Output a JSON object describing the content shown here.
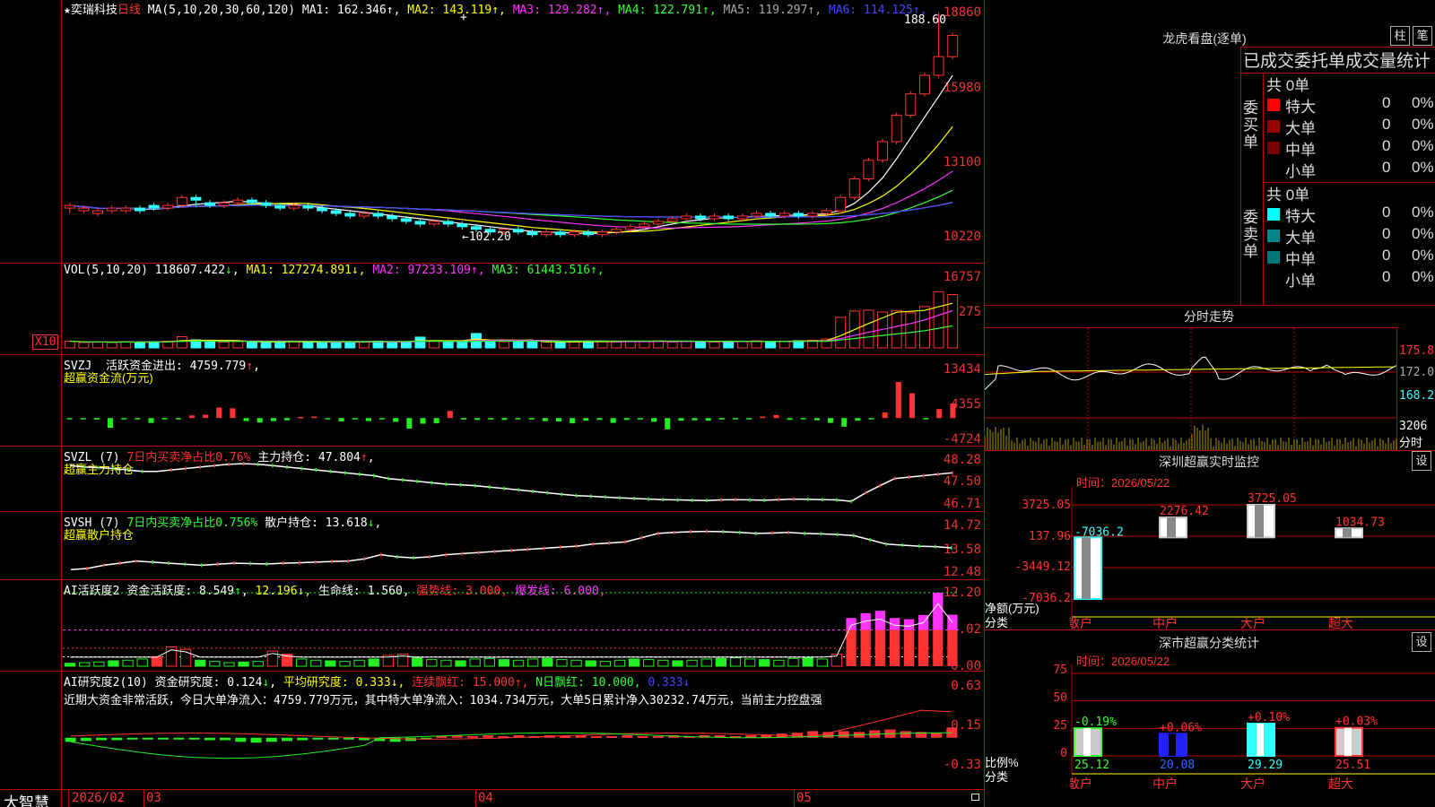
{
  "stock": {
    "name": "奕瑞科技",
    "period": "日线",
    "ma_params": "MA(5,10,20,30,60,120)",
    "ma": [
      {
        "label": "MA1:",
        "value": "162.346",
        "arrow": "↑",
        "color": "#ffffff"
      },
      {
        "label": "MA2:",
        "value": "143.119",
        "arrow": "↑",
        "color": "#ffff00"
      },
      {
        "label": "MA3:",
        "value": "129.282",
        "arrow": "↑",
        "color": "#ff33ff"
      },
      {
        "label": "MA4:",
        "value": "122.791",
        "arrow": "↑",
        "color": "#33ff33"
      },
      {
        "label": "MA5:",
        "value": "119.297",
        "arrow": "↑",
        "color": "#aaaaaa"
      },
      {
        "label": "MA6:",
        "value": "114.125",
        "arrow": "↑",
        "color": "#4444ff"
      }
    ],
    "y_labels": [
      "18860",
      "15980",
      "13100",
      "10220"
    ],
    "high_label": "188.60",
    "low_label": "102.20"
  },
  "vol": {
    "title": "VOL(5,10,20)",
    "value": "118607.422",
    "arrow": "↓",
    "ma": [
      {
        "label": "MA1:",
        "value": "127274.891",
        "arrow": "↓",
        "color": "#ffff00"
      },
      {
        "label": "MA2:",
        "value": "97233.109",
        "arrow": "↑",
        "color": "#ff33ff"
      },
      {
        "label": "MA3:",
        "value": "61443.516",
        "arrow": "↑",
        "color": "#33ff33"
      }
    ],
    "y_labels": [
      "16757",
      "8275"
    ],
    "unit": "X10"
  },
  "svzj": {
    "title": "SVZJ",
    "desc": "活跃资金进出:",
    "value": "4759.779",
    "arrow": "↑",
    "comma": ",",
    "sub": "超赢资金流(万元)",
    "y_labels": [
      "13434",
      "4355",
      "-4724"
    ]
  },
  "svzl": {
    "title": "SVZL (7)",
    "desc_red": "7日内买卖净占比0.76%",
    "main_label": "主力持仓:",
    "value": "47.804",
    "arrow": "↑",
    "comma": ",",
    "sub": "超赢主力持仓",
    "y_labels": [
      "48.28",
      "47.50",
      "46.71"
    ]
  },
  "svsh": {
    "title": "SVSH (7)",
    "desc_grn": "7日内买卖净占比0.756%",
    "main_label": "散户持仓:",
    "value": "13.618",
    "arrow": "↓",
    "comma": ",",
    "sub": "超赢散户持仓",
    "y_labels": [
      "14.72",
      "13.58",
      "12.48"
    ]
  },
  "ai_active": {
    "title": "AI活跃度2",
    "t1": "资金活跃度:",
    "v1": "8.549",
    "a1": "↑",
    "v2": "12.196",
    "t3": "生命线:",
    "v3": "1.560",
    "t4": "强势线:",
    "v4": "3.000",
    "t5": "爆发线:",
    "v5": "6.000",
    "y_labels": [
      "12.20",
      "6.02",
      "0.00"
    ]
  },
  "ai_research": {
    "title": "AI研究度2(10)",
    "t1": "资金研究度:",
    "v1": "0.124",
    "a1": "↓",
    "t2": "平均研究度:",
    "v2": "0.333",
    "a2": "↓",
    "t3": "连续飘红:",
    "v3": "15.000",
    "a3": "↑",
    "t4": "N日飘红:",
    "v4": "10.000",
    "v5": "0.333",
    "a5": "↓",
    "comment": "近期大资金非常活跃，今日大单净流入：4759.779万元，其中特大单净流入：1034.734万元，大单5日累计净入30232.74万元，当前主力控盘强",
    "y_labels": [
      "0.63",
      "0.15",
      "-0.33"
    ]
  },
  "xaxis": {
    "brand": "大智慧",
    "labels": [
      "2026/02",
      "03",
      "04",
      "05"
    ]
  },
  "dragon": {
    "title": "龙虎看盘(逐单)",
    "btn1": "柱",
    "btn2": "笔",
    "header": "已成交委托单成交量统计",
    "buy": {
      "side": "委买单",
      "total": "共 0单",
      "rows": [
        {
          "name": "特大",
          "count": "0",
          "pct": "0%",
          "color": "#ff0000"
        },
        {
          "name": "大单",
          "count": "0",
          "pct": "0%",
          "color": "#990000"
        },
        {
          "name": "中单",
          "count": "0",
          "pct": "0%",
          "color": "#770000"
        },
        {
          "name": "小单",
          "count": "0",
          "pct": "0%",
          "color": "#000000"
        }
      ]
    },
    "sell": {
      "side": "委卖单",
      "total": "共 0单",
      "rows": [
        {
          "name": "特大",
          "count": "0",
          "pct": "0%",
          "color": "#00ffff"
        },
        {
          "name": "大单",
          "count": "0",
          "pct": "0%",
          "color": "#008888"
        },
        {
          "name": "中单",
          "count": "0",
          "pct": "0%",
          "color": "#007777"
        },
        {
          "name": "小单",
          "count": "0",
          "pct": "0%",
          "color": "#000000"
        }
      ]
    }
  },
  "intraday": {
    "title": "分时走势",
    "prices": [
      "175.8",
      "172.0",
      "168.2"
    ],
    "vol_label": "3206",
    "unit": "分时"
  },
  "monitor": {
    "title": "深圳超赢实时监控",
    "btn": "设",
    "date_label": "时间：",
    "date": "2026/05/22",
    "y_labels": [
      "3725.05",
      "137.96",
      "-3449.12",
      "-7036.2"
    ],
    "axis_title": "净额(万元)",
    "axis_sub": "分类"
  },
  "classify": {
    "title": "深市超赢分类统计",
    "btn": "设",
    "date_label": "时间：",
    "date": "2026/05/22",
    "y_labels": [
      "75",
      "50",
      "25",
      "0"
    ],
    "axis_title": "比例%",
    "axis_sub": "分类"
  },
  "colors": {
    "up": "#ff3333",
    "down": "#33ffff",
    "grid": "#bb0000",
    "green": "#22ee22",
    "magenta": "#ff33ff"
  },
  "chart_data": [
    {
      "type": "candlestick",
      "title": "奕瑞科技 日线",
      "ylim": [
        102.2,
        188.6
      ],
      "ohlc": [
        [
          115,
          116,
          113,
          117
        ],
        [
          114,
          115,
          113,
          116
        ],
        [
          113,
          114,
          112,
          115
        ],
        [
          114,
          115,
          113,
          116
        ],
        [
          114,
          115,
          113,
          116
        ],
        [
          115,
          114,
          113,
          116
        ],
        [
          116,
          115,
          114,
          117
        ],
        [
          115,
          116,
          114,
          117
        ],
        [
          116,
          119,
          115,
          120
        ],
        [
          119,
          118,
          116,
          120
        ],
        [
          117,
          116,
          115,
          118
        ],
        [
          116,
          117,
          115,
          118
        ],
        [
          117,
          118,
          116,
          119
        ],
        [
          118,
          117,
          116,
          119
        ],
        [
          117,
          116,
          115,
          118
        ],
        [
          116,
          115,
          114,
          117
        ],
        [
          115,
          116,
          114,
          117
        ],
        [
          116,
          115,
          114,
          117
        ],
        [
          115,
          114,
          113,
          116
        ],
        [
          114,
          113,
          112,
          115
        ],
        [
          113,
          112,
          111,
          114
        ],
        [
          112,
          113,
          111,
          114
        ],
        [
          113,
          112,
          111,
          114
        ],
        [
          112,
          111,
          110,
          113
        ],
        [
          111,
          110,
          109,
          112
        ],
        [
          110,
          109,
          108,
          111
        ],
        [
          109,
          110,
          108,
          111
        ],
        [
          110,
          109,
          108,
          111
        ],
        [
          109,
          108,
          107,
          110
        ],
        [
          108,
          107,
          106,
          109
        ],
        [
          107,
          106,
          105,
          108
        ],
        [
          106,
          107,
          105,
          108
        ],
        [
          107,
          106,
          105,
          108
        ],
        [
          106,
          105,
          104,
          107
        ],
        [
          105,
          106,
          104,
          107
        ],
        [
          106,
          105,
          104,
          107
        ],
        [
          105,
          106,
          104,
          107
        ],
        [
          106,
          105,
          104,
          107
        ],
        [
          105,
          106,
          104,
          107
        ],
        [
          106,
          107,
          105,
          108
        ],
        [
          107,
          108,
          106,
          109
        ],
        [
          108,
          109,
          107,
          110
        ],
        [
          109,
          110,
          108,
          111
        ],
        [
          110,
          111,
          109,
          112
        ],
        [
          111,
          112,
          110,
          113
        ],
        [
          112,
          111,
          110,
          113
        ],
        [
          111,
          112,
          110,
          113
        ],
        [
          112,
          111,
          110,
          113
        ],
        [
          111,
          112,
          110,
          113
        ],
        [
          112,
          113,
          111,
          114
        ],
        [
          113,
          112,
          111,
          114
        ],
        [
          112,
          113,
          111,
          114
        ],
        [
          113,
          112,
          111,
          114
        ],
        [
          112,
          113,
          111,
          114
        ],
        [
          113,
          114,
          112,
          115
        ],
        [
          114,
          119,
          113,
          120
        ],
        [
          119,
          126,
          118,
          127
        ],
        [
          126,
          133,
          125,
          134
        ],
        [
          133,
          140,
          132,
          141
        ],
        [
          140,
          150,
          139,
          151
        ],
        [
          150,
          158,
          149,
          159
        ],
        [
          158,
          165,
          157,
          166
        ],
        [
          165,
          172,
          164,
          188.6
        ],
        [
          172,
          180,
          171,
          181
        ]
      ],
      "ma": [
        {
          "name": "MA1",
          "last": 162.346
        },
        {
          "name": "MA2",
          "last": 143.119
        },
        {
          "name": "MA3",
          "last": 129.282
        },
        {
          "name": "MA4",
          "last": 122.791
        },
        {
          "name": "MA5",
          "last": 119.297
        },
        {
          "name": "MA6",
          "last": 114.125
        }
      ]
    },
    {
      "type": "bar",
      "title": "VOL(5,10,20)",
      "ylim": [
        0,
        16757
      ],
      "values": [
        1500,
        1200,
        1300,
        1200,
        1400,
        1300,
        1400,
        1500,
        2500,
        1800,
        1300,
        1300,
        1400,
        1300,
        1400,
        1300,
        1400,
        1300,
        1200,
        1300,
        1400,
        1300,
        1500,
        1300,
        1400,
        2400,
        1500,
        1400,
        1300,
        3200,
        1500,
        1400,
        1300,
        1400,
        1300,
        1400,
        1300,
        1600,
        1400,
        1300,
        1500,
        1400,
        1600,
        1300,
        1400,
        1500,
        1300,
        1400,
        1500,
        1600,
        1400,
        1500,
        1600,
        1700,
        2000,
        6800,
        8200,
        8400,
        8000,
        8300,
        7800,
        9200,
        12500,
        11860
      ]
    },
    {
      "type": "bar",
      "title": "SVZJ 活跃资金进出",
      "ylim": [
        -4724,
        13434
      ],
      "values": [
        -300,
        -200,
        -400,
        -2600,
        -100,
        -200,
        -1300,
        -300,
        -300,
        700,
        900,
        2800,
        2600,
        -800,
        -1200,
        -800,
        -600,
        300,
        400,
        -200,
        -900,
        -200,
        -800,
        -300,
        -1000,
        -2800,
        -1500,
        -1400,
        1900,
        -400,
        -500,
        -400,
        -500,
        -300,
        -400,
        -800,
        -900,
        -1400,
        -700,
        -500,
        -1300,
        -500,
        -400,
        -1000,
        -3000,
        -700,
        -600,
        -700,
        -400,
        -200,
        -300,
        400,
        800,
        -500,
        -200,
        -600,
        -1300,
        -2300,
        -700,
        -300,
        1500,
        9600,
        6600,
        -300,
        2400,
        3900
      ]
    },
    {
      "type": "line",
      "title": "SVZL 主力持仓",
      "ylim": [
        46.71,
        48.28
      ],
      "values": [
        48.05,
        48.0,
        47.98,
        47.95,
        47.9,
        47.85,
        47.85,
        47.9,
        47.95,
        48.0,
        48.05,
        48.1,
        48.12,
        48.1,
        48.05,
        48.0,
        47.95,
        47.9,
        47.85,
        47.8,
        47.75,
        47.7,
        47.6,
        47.55,
        47.5,
        47.45,
        47.4,
        47.38,
        47.35,
        47.3,
        47.25,
        47.2,
        47.15,
        47.1,
        47.05,
        47.0,
        46.98,
        46.95,
        46.92,
        46.9,
        46.88,
        46.86,
        46.85,
        46.84,
        46.83,
        46.85,
        46.86,
        46.85,
        46.84,
        46.86,
        46.88,
        46.87,
        46.86,
        46.85,
        46.8,
        47.1,
        47.35,
        47.6,
        47.65,
        47.7,
        47.75,
        47.8
      ]
    },
    {
      "type": "line",
      "title": "SVSH 散户持仓",
      "ylim": [
        12.48,
        14.72
      ],
      "values": [
        12.6,
        12.65,
        12.8,
        12.9,
        13.0,
        12.95,
        12.9,
        12.85,
        12.8,
        12.85,
        12.9,
        12.88,
        12.86,
        12.9,
        12.92,
        12.95,
        12.98,
        13.0,
        13.1,
        13.3,
        13.2,
        13.15,
        13.2,
        13.3,
        13.35,
        13.4,
        13.45,
        13.5,
        13.55,
        13.6,
        13.65,
        13.7,
        13.8,
        13.85,
        13.9,
        14.1,
        14.3,
        14.35,
        14.38,
        14.4,
        14.38,
        14.35,
        14.3,
        14.32,
        14.35,
        14.3,
        14.28,
        14.25,
        14.2,
        14.0,
        13.8,
        13.75,
        13.7,
        13.68,
        13.62
      ]
    },
    {
      "type": "bar",
      "title": "AI活跃度2",
      "ylim": [
        0,
        12.2
      ],
      "threshold_lines": [
        1.56,
        3.0,
        6.0
      ],
      "values": [
        0.5,
        0.6,
        0.7,
        0.9,
        1.0,
        1.2,
        1.6,
        3.2,
        2.8,
        1.0,
        0.8,
        0.6,
        0.7,
        0.8,
        2.5,
        2.0,
        1.2,
        1.0,
        0.9,
        0.8,
        1.0,
        1.2,
        1.8,
        2.0,
        1.4,
        1.1,
        1.0,
        0.9,
        1.2,
        1.3,
        1.1,
        1.0,
        1.2,
        1.3,
        1.1,
        1.0,
        0.9,
        0.8,
        1.0,
        1.2,
        1.1,
        1.0,
        0.9,
        1.0,
        1.2,
        1.3,
        1.4,
        1.2,
        1.1,
        1.0,
        1.3,
        1.4,
        1.2,
        2.0,
        8.0,
        8.8,
        9.2,
        8.0,
        7.8,
        8.5,
        12.2,
        8.549
      ]
    },
    {
      "type": "bar",
      "title": "AI研究度2(10)",
      "ylim": [
        -0.33,
        0.63
      ],
      "values": [
        -0.05,
        -0.04,
        -0.03,
        -0.03,
        -0.02,
        -0.02,
        -0.02,
        -0.01,
        -0.02,
        -0.03,
        -0.03,
        -0.05,
        -0.06,
        -0.05,
        -0.04,
        -0.03,
        -0.02,
        -0.02,
        -0.02,
        -0.03,
        -0.04,
        -0.05,
        -0.04,
        -0.02,
        0.02,
        0.03,
        0.02,
        0.03,
        0.02,
        0.03,
        0.02,
        0.03,
        0.02,
        0.03,
        0.02,
        0.02,
        0.03,
        0.02,
        0.02,
        0.03,
        0.02,
        0.03,
        0.03,
        0.02,
        0.03,
        0.04,
        0.05,
        0.06,
        0.08,
        0.07,
        0.08,
        0.07,
        0.09,
        0.1,
        0.08,
        0.07,
        0.06,
        0.124
      ]
    },
    {
      "type": "bar",
      "title": "深圳超赢实时监控",
      "categories": [
        "散户",
        "中户",
        "大户",
        "超大"
      ],
      "values": [
        -7036.2,
        2276.42,
        3725.05,
        1034.73
      ],
      "ylim": [
        -7036.2,
        3725.05
      ]
    },
    {
      "type": "bar",
      "title": "深市超赢分类统计",
      "categories": [
        "散户",
        "中户",
        "大户",
        "超大"
      ],
      "values": [
        25.12,
        20.08,
        29.29,
        25.51
      ],
      "changes": [
        "-0.19%",
        "+0.06%",
        "+0.10%",
        "+0.03%"
      ],
      "ylim": [
        0,
        75
      ]
    }
  ]
}
